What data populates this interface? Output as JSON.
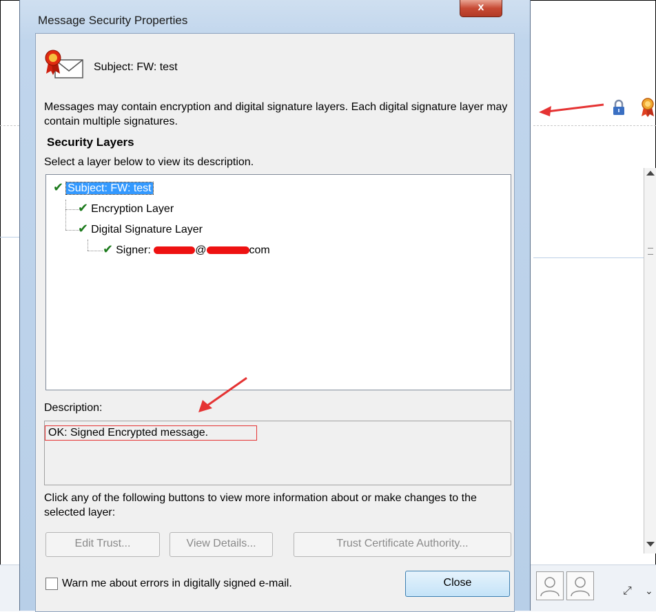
{
  "dialog": {
    "title": "Message Security Properties",
    "close_label": "x",
    "subject_line": "Subject:  FW: test",
    "intro": "Messages may contain encryption and digital signature layers. Each digital signature layer may contain multiple signatures.",
    "security_layers_heading": "Security Layers",
    "select_hint": "Select a layer below to view its description.",
    "tree": {
      "root": "Subject: FW: test",
      "encryption": "Encryption Layer",
      "signature": "Digital Signature Layer",
      "signer_prefix": "Signer:",
      "signer_at": "@",
      "signer_suffix": "com"
    },
    "description_label": "Description:",
    "description_text": "OK: Signed Encrypted message.",
    "click_info": "Click any of the following buttons to view more information about or make changes to the selected layer:",
    "buttons": {
      "edit_trust": "Edit Trust...",
      "view_details": "View Details...",
      "trust_ca": "Trust Certificate Authority...",
      "close": "Close"
    },
    "warn_checkbox": {
      "label": "Warn me about errors in digitally signed e-mail.",
      "checked": false
    }
  },
  "colors": {
    "annotation_red": "#e53333",
    "check_green": "#1c7a1c",
    "selection_blue": "#3399ff"
  },
  "icons": {
    "certificate": "certificate-envelope-icon",
    "lock": "lock-icon",
    "award": "award-ribbon-icon"
  }
}
